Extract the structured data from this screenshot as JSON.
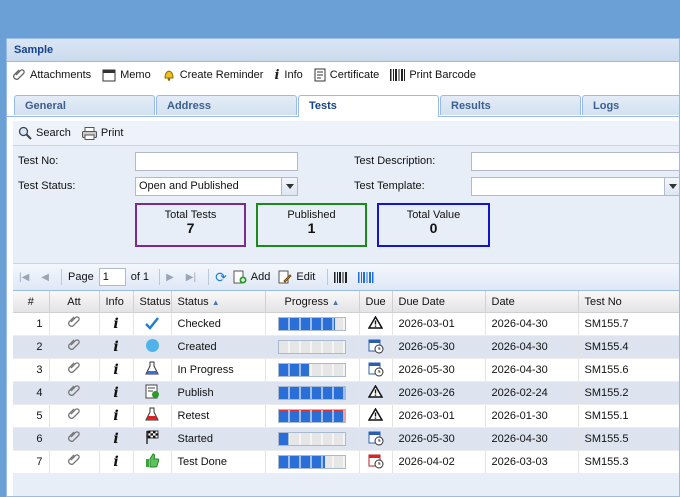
{
  "window_title": "Sample",
  "toolbar": {
    "attachments": "Attachments",
    "memo": "Memo",
    "create_reminder": "Create Reminder",
    "info": "Info",
    "certificate": "Certificate",
    "print_barcode": "Print Barcode"
  },
  "tabs": [
    {
      "label": "General"
    },
    {
      "label": "Address"
    },
    {
      "label": "Tests"
    },
    {
      "label": "Results"
    },
    {
      "label": "Logs"
    }
  ],
  "subtoolbar": {
    "search": "Search",
    "print": "Print"
  },
  "form": {
    "test_no_label": "Test No:",
    "test_no_value": "",
    "test_status_label": "Test Status:",
    "test_status_value": "Open and Published",
    "test_description_label": "Test Description:",
    "test_description_value": "",
    "test_template_label": "Test Template:",
    "test_template_value": ""
  },
  "stats": {
    "total_tests_label": "Total Tests",
    "total_tests_value": "7",
    "total_tests_color": "#7b2a8e",
    "published_label": "Published",
    "published_value": "1",
    "published_color": "#1a8a1a",
    "total_value_label": "Total Value",
    "total_value_value": "0",
    "total_value_color": "#1414c8"
  },
  "pager": {
    "page_label": "Page",
    "page_value": "1",
    "of_label": "of 1",
    "add": "Add",
    "edit": "Edit"
  },
  "columns": [
    "#",
    "Att",
    "Info",
    "Status",
    "Status",
    "Progress",
    "Due",
    "Due Date",
    "Date",
    "Test No"
  ],
  "rows": [
    {
      "n": "1",
      "status_icon": "checkmark-icon",
      "status": "Checked",
      "progress": 0.85,
      "progress_style": "blue",
      "due_icon": "warning-icon",
      "due_date": "2026-03-01",
      "date": "2026-04-30",
      "test_no": "SM155.7"
    },
    {
      "n": "2",
      "status_icon": "circle-icon",
      "status": "Created",
      "progress": 0.0,
      "progress_style": "blue",
      "due_icon": "calendar-clock-icon",
      "due_date": "2026-05-30",
      "date": "2026-04-30",
      "test_no": "SM155.4"
    },
    {
      "n": "3",
      "status_icon": "flask-icon",
      "status": "In Progress",
      "progress": 0.45,
      "progress_style": "blue",
      "due_icon": "calendar-clock-icon",
      "due_date": "2026-05-30",
      "date": "2026-04-30",
      "test_no": "SM155.6"
    },
    {
      "n": "4",
      "status_icon": "publish-icon",
      "status": "Publish",
      "progress": 1.0,
      "progress_style": "blue",
      "due_icon": "warning-icon",
      "due_date": "2026-03-26",
      "date": "2026-02-24",
      "test_no": "SM155.2"
    },
    {
      "n": "5",
      "status_icon": "red-flask-icon",
      "status": "Retest",
      "progress": 1.0,
      "progress_style": "red",
      "due_icon": "warning-icon",
      "due_date": "2026-03-01",
      "date": "2026-01-30",
      "test_no": "SM155.1"
    },
    {
      "n": "6",
      "status_icon": "checkered-flag-icon",
      "status": "Started",
      "progress": 0.15,
      "progress_style": "blue",
      "due_icon": "calendar-clock-icon",
      "due_date": "2026-05-30",
      "date": "2026-04-30",
      "test_no": "SM155.5"
    },
    {
      "n": "7",
      "status_icon": "thumbs-up-icon",
      "status": "Test Done",
      "progress": 0.7,
      "progress_style": "blue",
      "due_icon": "calendar-red-icon",
      "due_date": "2026-04-02",
      "date": "2026-03-03",
      "test_no": "SM155.3"
    }
  ]
}
